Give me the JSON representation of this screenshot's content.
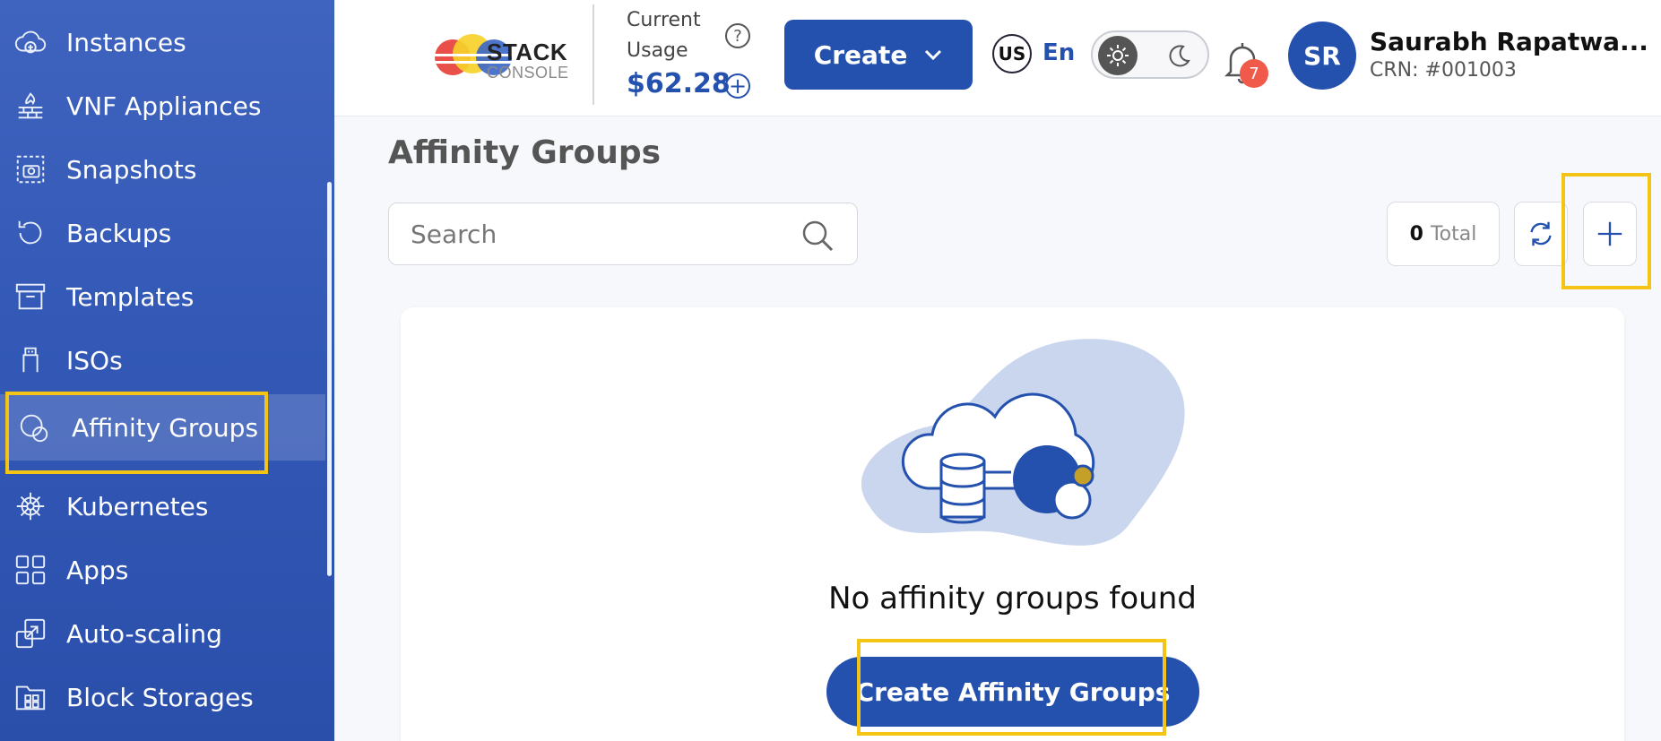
{
  "sidebar": {
    "items": [
      {
        "label": "Instances",
        "icon": "cloud-plus-icon"
      },
      {
        "label": "VNF Appliances",
        "icon": "firewall-icon"
      },
      {
        "label": "Snapshots",
        "icon": "camera-icon"
      },
      {
        "label": "Backups",
        "icon": "history-icon"
      },
      {
        "label": "Templates",
        "icon": "archive-box-icon"
      },
      {
        "label": "ISOs",
        "icon": "usb-icon"
      },
      {
        "label": "Affinity Groups",
        "icon": "circles-icon"
      },
      {
        "label": "Kubernetes",
        "icon": "helm-wheel-icon"
      },
      {
        "label": "Apps",
        "icon": "grid-icon"
      },
      {
        "label": "Auto-scaling",
        "icon": "scale-icon"
      },
      {
        "label": "Block Storages",
        "icon": "folder-grid-icon"
      }
    ],
    "active_item": "Affinity Groups"
  },
  "header": {
    "logo_line1": "STACK",
    "logo_line2": "CONSOLE",
    "usage_label": "Current Usage",
    "help_symbol": "?",
    "usage_amount": "$62.28",
    "create_label": "Create",
    "region_code": "US",
    "language": "En",
    "notification_count": "7",
    "avatar_initials": "SR",
    "user_name": "Saurabh Rapatwa...",
    "crn": "CRN: #001003"
  },
  "main": {
    "title": "Affinity Groups",
    "search_placeholder": "Search",
    "total_count": "0",
    "total_label": "Total",
    "empty_message": "No affinity groups found",
    "cta_label": "Create Affinity Groups"
  },
  "colors": {
    "brand": "#2450ae",
    "highlight": "#f3c316",
    "sidebar": "#3358b6",
    "badge": "#ef5a4a"
  }
}
